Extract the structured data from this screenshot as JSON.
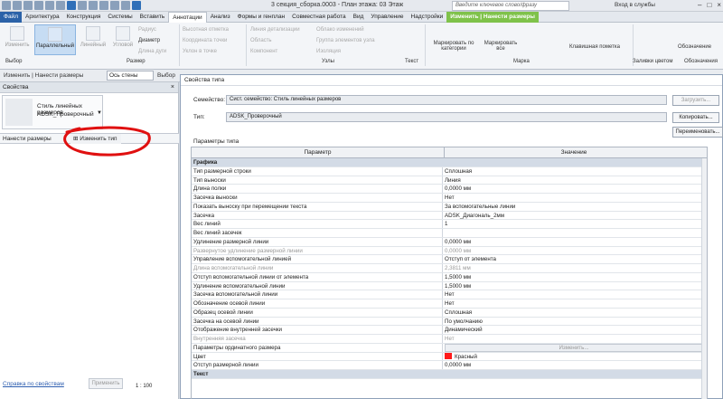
{
  "window": {
    "title": "3 секция_сборка.0003 - План этажа: 03 Этаж",
    "search_placeholder": "Введите ключевое слово/фразу",
    "login": "Вход в службы"
  },
  "tabs": [
    {
      "label": "Файл"
    },
    {
      "label": "Архитектура"
    },
    {
      "label": "Конструкция"
    },
    {
      "label": "Системы"
    },
    {
      "label": "Вставить"
    },
    {
      "label": "Аннотации"
    },
    {
      "label": "Анализ"
    },
    {
      "label": "Формы и генплан"
    },
    {
      "label": "Совместная работа"
    },
    {
      "label": "Вид"
    },
    {
      "label": "Управление"
    },
    {
      "label": "Надстройки"
    },
    {
      "label": "Изменить | Нанести размеры"
    }
  ],
  "ribbon": {
    "modify": "Изменить",
    "parallel": "Параллельный",
    "linear": "Линейный",
    "angular": "Угловой",
    "radius": "Радиус",
    "diameter": "Диаметр",
    "arc_length": "Длина дуги",
    "spot_elevation": "Высотная отметка",
    "spot_coordinate": "Координата точки",
    "spot_slope": "Уклон в точке",
    "detail_line": "Линия детализации",
    "region": "Область",
    "component": "Компонент",
    "revision_cloud": "Облако изменений",
    "detail_group": "Группа элементов узла",
    "insulation": "Изоляция",
    "tag_by_category": "Маркировать по категории",
    "tag_all": "Маркировать все",
    "keynote": "Клавишная пометка",
    "annotation_right": "Обозначение",
    "panel_select": "Выбор",
    "panel_size": "Размер",
    "panel_detail": "Узлы",
    "panel_text": "Текст",
    "panel_tag": "Марка",
    "panel_color": "Заливки цветом",
    "panel_symbol": "Обозначения"
  },
  "optbar": {
    "modify_label": "Изменить | Нанести размеры",
    "axis_box": "Ось стены",
    "pick_label": "Выбор"
  },
  "properties": {
    "header": "Свойства",
    "close": "×",
    "type_line1": "Стиль линейных размеров",
    "type_line2": "ADSK_Проверочный",
    "category_label": "Нанести размеры",
    "edit_type": "Изменить тип",
    "help_link": "Справка по свойствам",
    "apply": "Применить",
    "scale": "1 : 100"
  },
  "dialog": {
    "title": "Свойства типа",
    "family_label": "Семейство:",
    "family_value": "Сист. семейство: Стиль линейных размеров",
    "type_label": "Тип:",
    "type_value": "ADSK_Проверочный",
    "load_btn": "Загрузить...",
    "duplicate_btn": "Копировать...",
    "rename_btn": "Переименовать...",
    "params_label": "Параметры типа",
    "col_param": "Параметр",
    "col_value": "Значение"
  },
  "table_rows": [
    {
      "kind": "grp",
      "p": "Графика",
      "v": ""
    },
    {
      "kind": "",
      "p": "Тип размерной строки",
      "v": "Сплошная"
    },
    {
      "kind": "",
      "p": "Тип выноски",
      "v": "Линия"
    },
    {
      "kind": "",
      "p": "Длина полки",
      "v": "0,0000 мм"
    },
    {
      "kind": "",
      "p": "Засечка выноски",
      "v": "Нет"
    },
    {
      "kind": "",
      "p": "Показать выноску при перемещении текста",
      "v": "За вспомогательные линии"
    },
    {
      "kind": "",
      "p": "Засечка",
      "v": "ADSK_Диагональ_2мм"
    },
    {
      "kind": "",
      "p": "Вес линий",
      "v": "1"
    },
    {
      "kind": "",
      "p": "Вес линий засечек",
      "v": ""
    },
    {
      "kind": "",
      "p": "Удлинение размерной линии",
      "v": "0,0000 мм"
    },
    {
      "kind": "gray",
      "p": "Развернутое удлинение размерной линии",
      "v": "0,0000 мм"
    },
    {
      "kind": "",
      "p": "Управление вспомогательной линией",
      "v": "Отступ от элемента"
    },
    {
      "kind": "gray",
      "p": "Длина вспомогательной линии",
      "v": "2,3811 мм"
    },
    {
      "kind": "",
      "p": "Отступ вспомогательной линии от элемента",
      "v": "1,5000 мм"
    },
    {
      "kind": "",
      "p": "Удлинение вспомогательной линии",
      "v": "1,5000 мм"
    },
    {
      "kind": "",
      "p": "Засечка вспомогательной линии",
      "v": "Нет"
    },
    {
      "kind": "",
      "p": "Обозначение осевой линии",
      "v": "Нет"
    },
    {
      "kind": "",
      "p": "Образец осевой линии",
      "v": "Сплошная"
    },
    {
      "kind": "",
      "p": "Засечка на осевой линии",
      "v": "По умолчанию"
    },
    {
      "kind": "",
      "p": "Отображение внутренней засечки",
      "v": "Динамический"
    },
    {
      "kind": "gray",
      "p": "Внутренняя засечка",
      "v": "Нет"
    },
    {
      "kind": "btn",
      "p": "Параметры ординатного размера",
      "v": "Изменить..."
    },
    {
      "kind": "color",
      "p": "Цвет",
      "v": "Красный"
    },
    {
      "kind": "",
      "p": "Отступ размерной линии",
      "v": "0,0000 мм"
    },
    {
      "kind": "grp",
      "p": "Текст",
      "v": ""
    }
  ]
}
